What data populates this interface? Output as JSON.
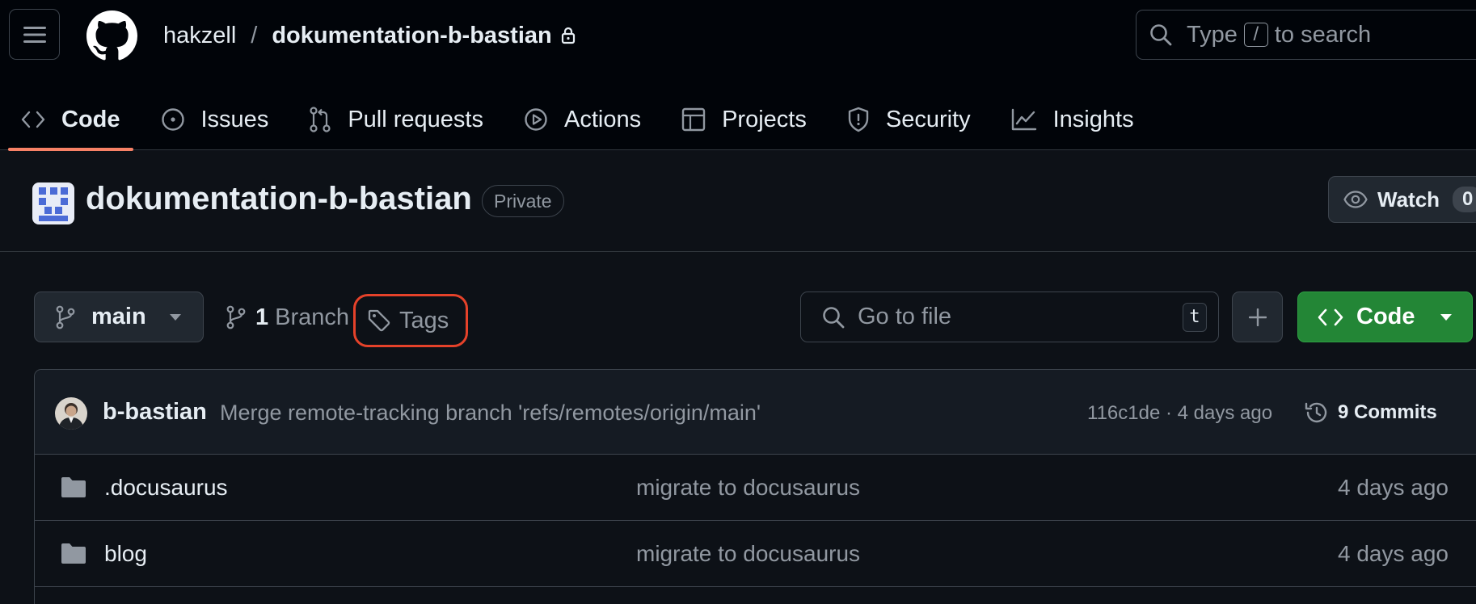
{
  "header": {
    "owner": "hakzell",
    "separator": "/",
    "repo": "dokumentation-b-bastian",
    "search": {
      "prefix": "Type",
      "key": "/",
      "suffix": "to search"
    }
  },
  "tabs": [
    {
      "label": "Code",
      "icon": "code-icon",
      "active": true
    },
    {
      "label": "Issues",
      "icon": "issue-opened-icon"
    },
    {
      "label": "Pull requests",
      "icon": "git-pull-request-icon"
    },
    {
      "label": "Actions",
      "icon": "play-icon"
    },
    {
      "label": "Projects",
      "icon": "table-icon"
    },
    {
      "label": "Security",
      "icon": "shield-icon"
    },
    {
      "label": "Insights",
      "icon": "graph-icon"
    }
  ],
  "repo": {
    "name": "dokumentation-b-bastian",
    "visibility": "Private",
    "watch_label": "Watch",
    "watch_count": "0"
  },
  "toolbar": {
    "branch": "main",
    "branch_count": "1",
    "branch_label": "Branch",
    "tags_label": "Tags",
    "goto_placeholder": "Go to file",
    "goto_shortcut": "t",
    "code_label": "Code"
  },
  "commit": {
    "author": "b-bastian",
    "message": "Merge remote-tracking branch 'refs/remotes/origin/main'",
    "meta": "116c1de · 4 days ago",
    "count_label": "9 Commits"
  },
  "files": [
    {
      "name": ".docusaurus",
      "message": "migrate to docusaurus",
      "date": "4 days ago",
      "type": "folder"
    },
    {
      "name": "blog",
      "message": "migrate to docusaurus",
      "date": "4 days ago",
      "type": "folder"
    }
  ],
  "colors": {
    "background": "#0d1117",
    "header": "#010409",
    "border": "#3d444d",
    "accent_underline": "#f78166",
    "primary_button": "#238636",
    "highlight_ring": "#e5422a"
  }
}
